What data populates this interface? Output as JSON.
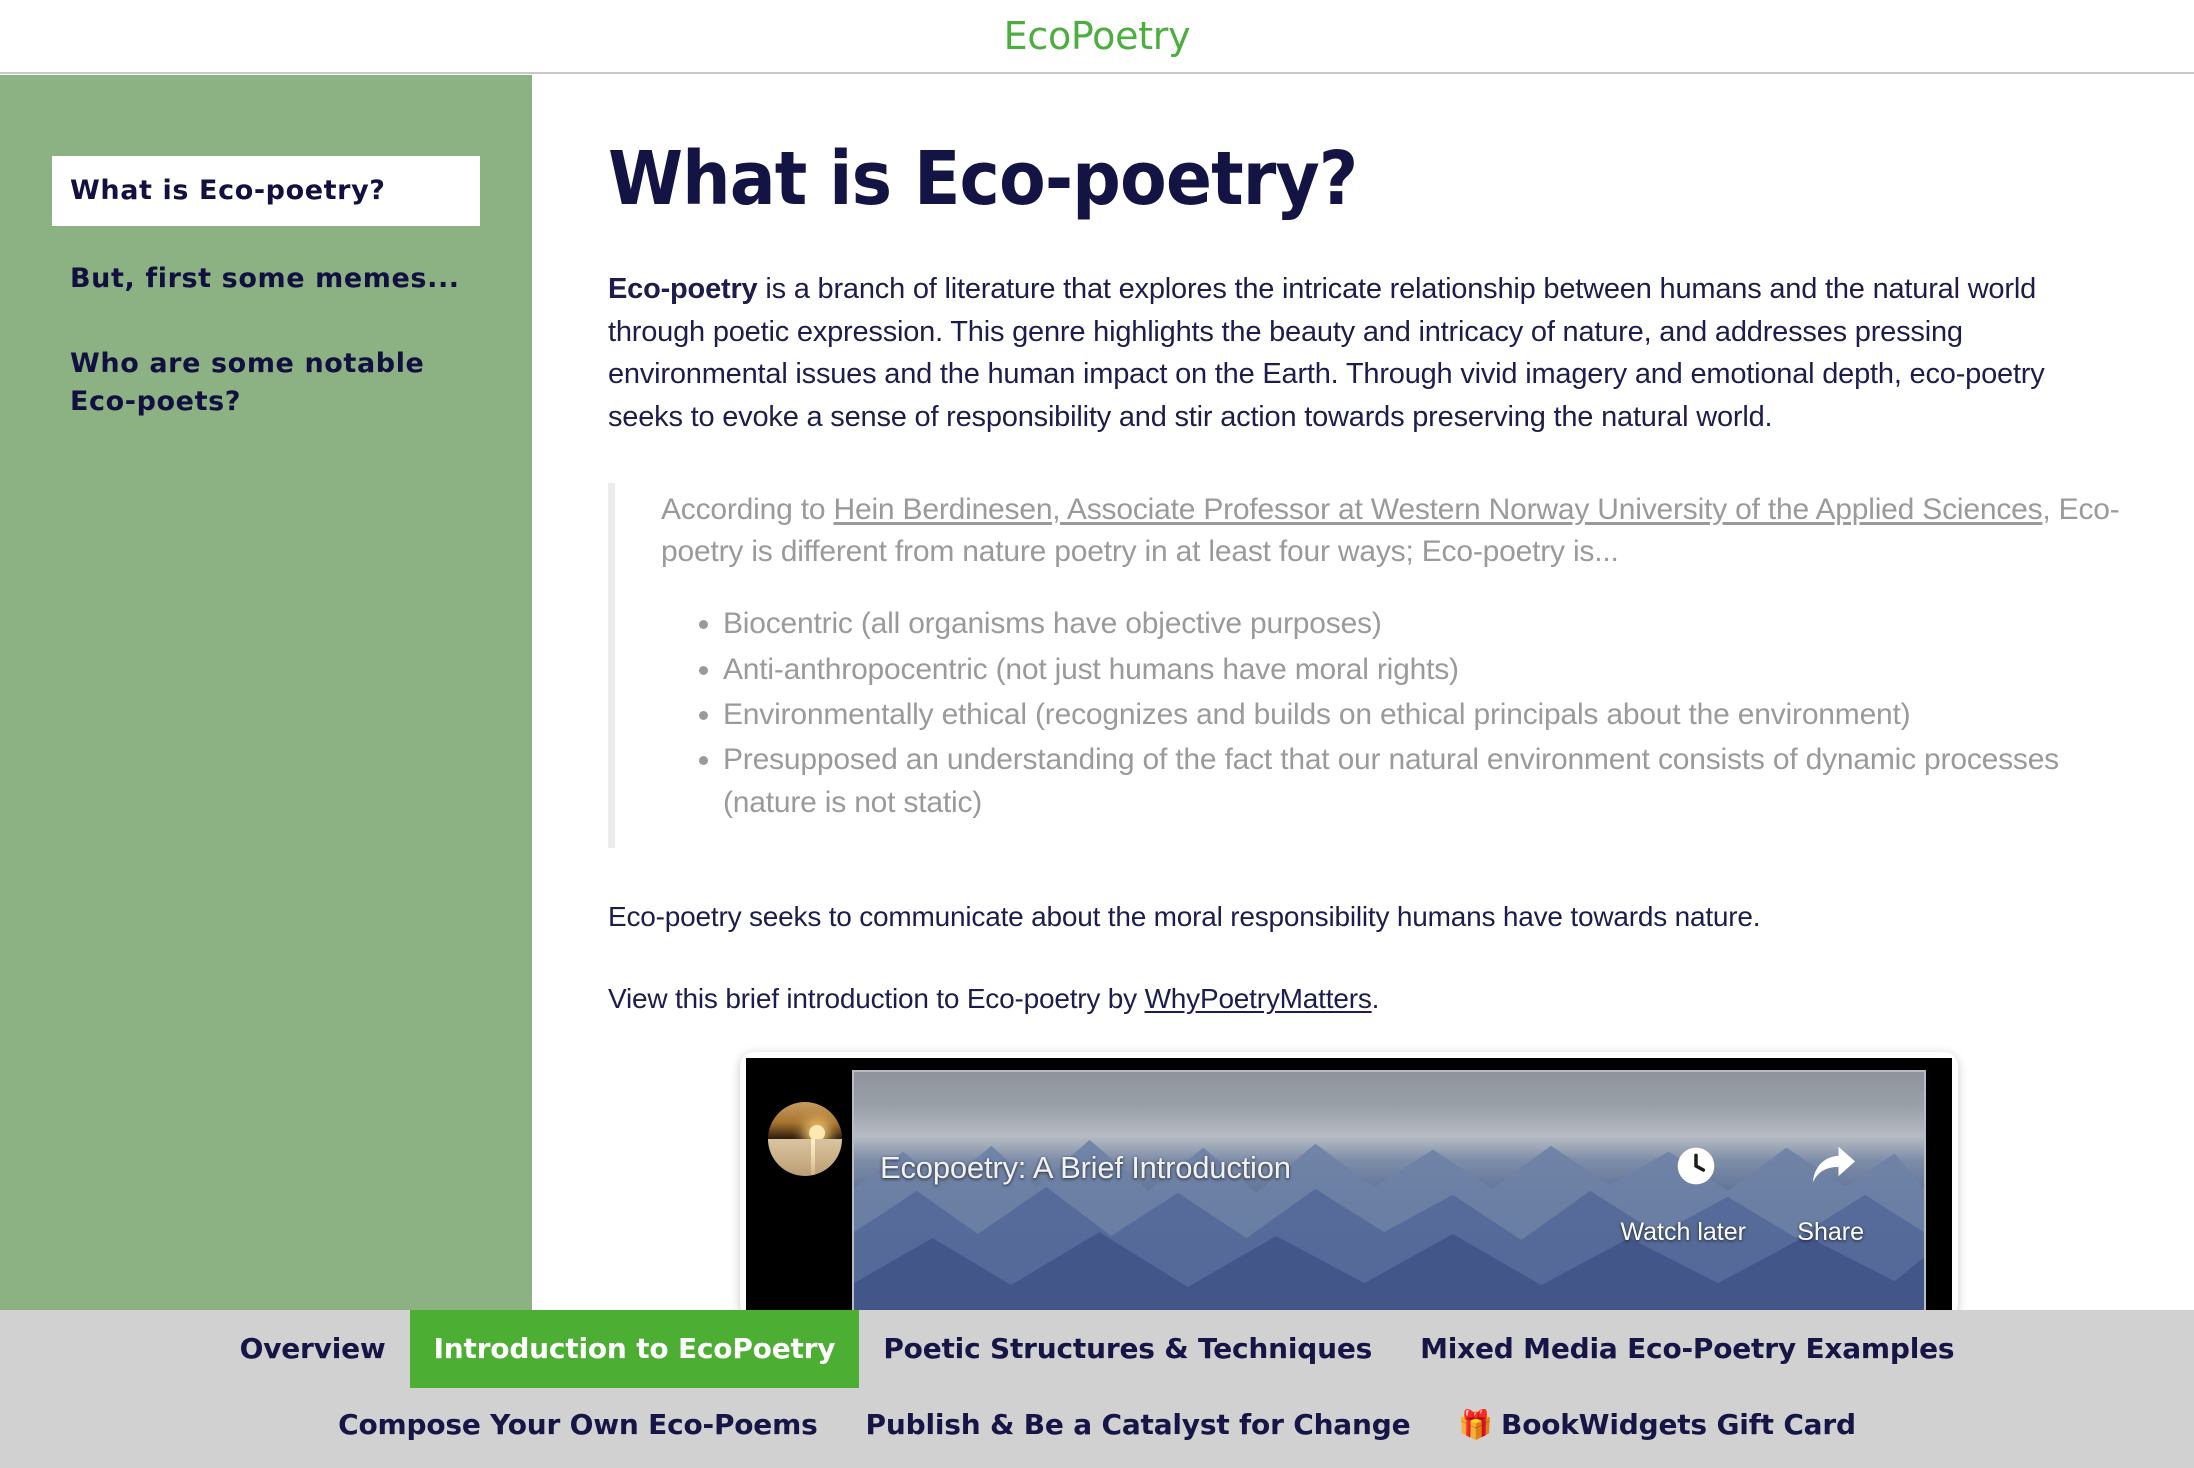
{
  "header": {
    "title": "EcoPoetry",
    "brand_color": "#4cae3e"
  },
  "sidebar": {
    "background_color": "#8cb183",
    "items": [
      {
        "label": "What is Eco-poetry?",
        "active": true
      },
      {
        "label": "But, first some memes...",
        "active": false
      },
      {
        "label": "Who are some notable Eco-poets?",
        "active": false
      }
    ]
  },
  "main": {
    "page_title": "What is Eco-poetry?",
    "intro": {
      "lead": "Eco-poetry",
      "rest": " is a branch of literature that explores the intricate relationship between humans and the natural world through poetic expression. This genre highlights the beauty and intricacy of nature, and addresses pressing environmental issues and the human impact on the Earth. Through vivid imagery and emotional depth, eco-poetry seeks to evoke a sense of responsibility and stir action towards preserving the natural world."
    },
    "quote": {
      "prefix": "According to ",
      "link_text": "Hein Berdinesen, Associate Professor at Western Norway University of the Applied Sciences",
      "suffix": ", Eco-poetry is different from nature poetry in at least four ways; Eco-poetry is...",
      "bullets": [
        "Biocentric (all organisms have objective purposes)",
        "Anti-anthropocentric (not just humans have moral rights)",
        "Environmentally ethical (recognizes and builds on ethical principals about the environment)",
        "Presupposed an understanding of the fact that our natural environment consists of dynamic processes (nature is not static)"
      ]
    },
    "closing_paragraph": "Eco-poetry seeks to communicate about the moral responsibility humans have towards nature.",
    "video_intro": {
      "prefix": "View this brief introduction to Eco-poetry by ",
      "link_text": "WhyPoetryMatters",
      "suffix": "."
    },
    "video": {
      "title": "Ecopoetry: A Brief Introduction",
      "watch_later_label": "Watch later",
      "share_label": "Share"
    }
  },
  "tabbar": {
    "background_color": "#d1d1d1",
    "active_color": "#4cae32",
    "row1": [
      {
        "label": "Overview",
        "active": false
      },
      {
        "label": "Introduction to EcoPoetry",
        "active": true
      },
      {
        "label": "Poetic Structures & Techniques",
        "active": false
      },
      {
        "label": "Mixed Media Eco-Poetry Examples",
        "active": false
      }
    ],
    "row2": [
      {
        "label": "Compose Your Own Eco-Poems",
        "active": false
      },
      {
        "label": "Publish & Be a Catalyst for Change",
        "active": false
      },
      {
        "label": "BookWidgets Gift Card",
        "active": false,
        "icon": "gift-icon",
        "glyph": "🎁"
      }
    ]
  }
}
